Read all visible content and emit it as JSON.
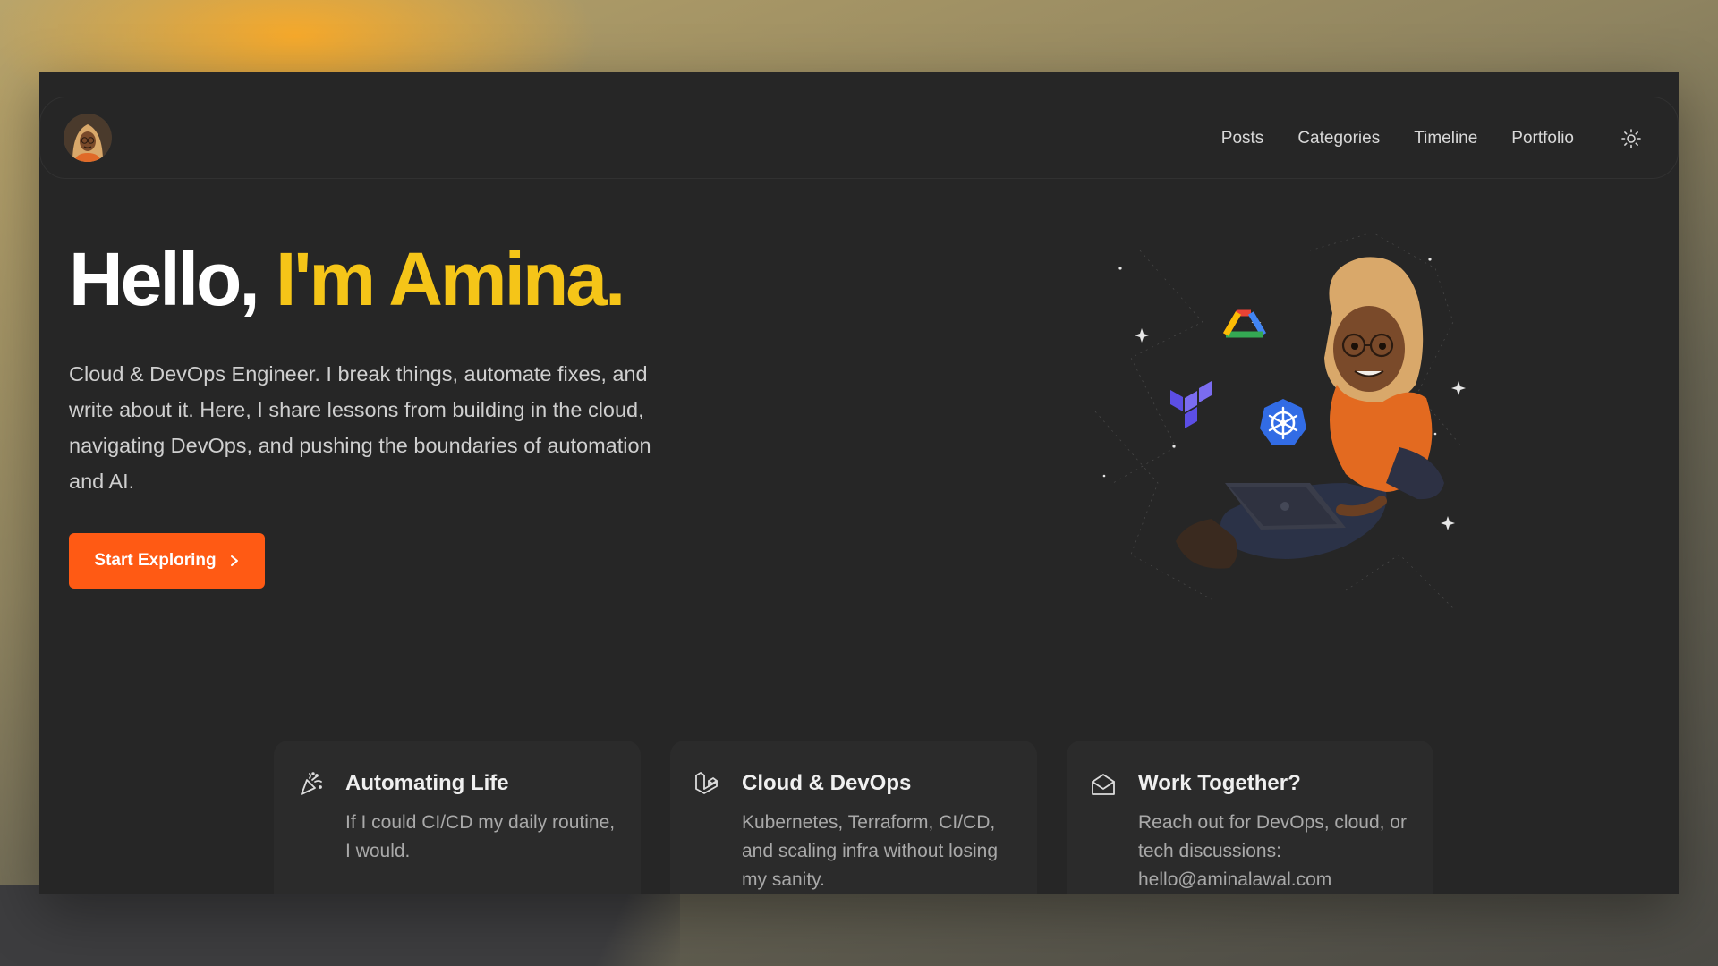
{
  "nav": {
    "items": [
      {
        "label": "Posts"
      },
      {
        "label": "Categories"
      },
      {
        "label": "Timeline"
      },
      {
        "label": "Portfolio"
      }
    ],
    "theme_toggle_icon": "sun-icon"
  },
  "hero": {
    "greeting": "Hello,",
    "name": "I'm Amina.",
    "description": "Cloud & DevOps Engineer. I break things, automate fixes, and write about it. Here, I share lessons from building in the cloud, navigating DevOps, and pushing the boundaries of automation and AI.",
    "cta_label": "Start Exploring",
    "cta_icon": "chevron-right-icon"
  },
  "cards": [
    {
      "icon": "party-popper-icon",
      "title": "Automating Life",
      "text": "If I could CI/CD my daily routine, I would."
    },
    {
      "icon": "laravel-icon",
      "title": "Cloud & DevOps",
      "text": "Kubernetes, Terraform, CI/CD, and scaling infra without losing my sanity."
    },
    {
      "icon": "mail-open-icon",
      "title": "Work Together?",
      "text": "Reach out for DevOps, cloud, or tech discussions: hello@aminalawal.com"
    }
  ],
  "colors": {
    "accent": "#f5c518",
    "cta": "#ff5a14",
    "window_bg": "#262626",
    "card_bg": "#2b2b2b"
  }
}
